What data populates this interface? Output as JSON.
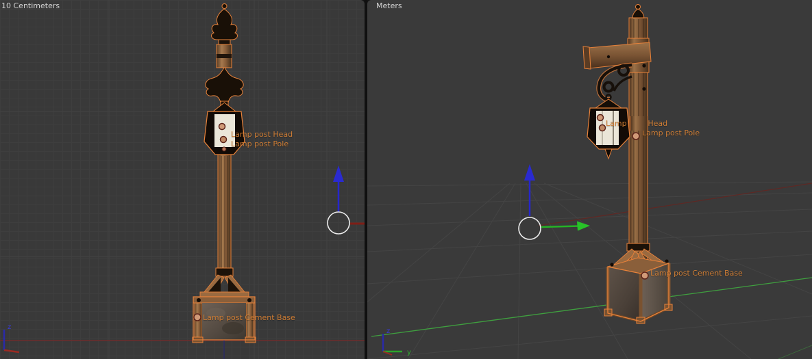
{
  "left_viewport": {
    "header": "10 Centimeters",
    "gizmo": {
      "z_label": "z"
    }
  },
  "right_viewport": {
    "header": "Meters",
    "gizmo": {
      "z_label": "z",
      "y_label": "y"
    }
  },
  "object_labels": {
    "head": "Lamp post Head",
    "pole": "Lamp post Pole",
    "base": "Lamp post Cement Base"
  },
  "colors": {
    "viewport_background": "#393939",
    "header_text": "#d4d4d4",
    "label_orange": "#ce7d35",
    "selection_outline": "#e8823a",
    "axis_x_red": "#9a2a22",
    "axis_y_green": "#2aa52a",
    "axis_z_blue": "#2a2ac8",
    "manipulator_circle": "#ececec",
    "lantern_glass": "#ebe6d8",
    "wood_brown": "#8a5f3a",
    "iron_dark": "#17100a"
  }
}
